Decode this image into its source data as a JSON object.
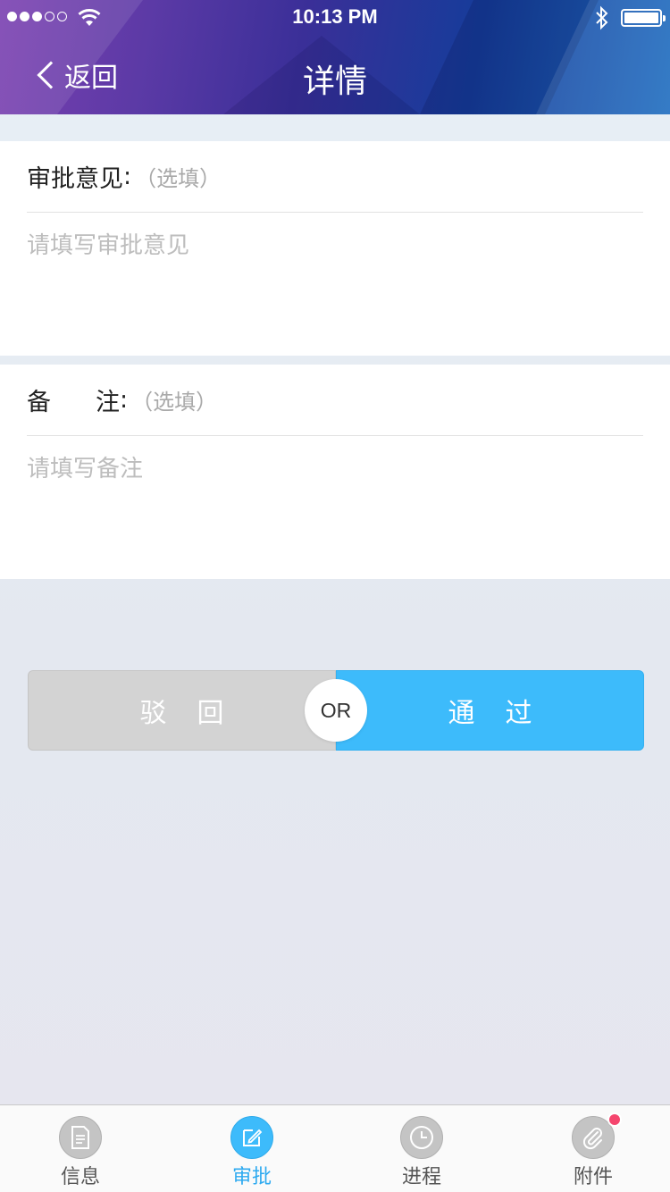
{
  "status_bar": {
    "time": "10:13 PM"
  },
  "nav": {
    "back_label": "返回",
    "title": "详情"
  },
  "approval": {
    "label": "审批意见",
    "colon": ":",
    "optional": "（选填）",
    "placeholder": "请填写审批意见"
  },
  "remark": {
    "label": "备注",
    "colon": ":",
    "optional": "（选填）",
    "placeholder": "请填写备注"
  },
  "actions": {
    "reject_label": "驳回",
    "or_label": "OR",
    "pass_label": "通过",
    "reject_color": "#d3d3d3",
    "pass_color": "#3dbbfb"
  },
  "tabbar": {
    "tabs": [
      {
        "label": "信息",
        "icon": "document-icon",
        "active": false
      },
      {
        "label": "审批",
        "icon": "edit-icon",
        "active": true
      },
      {
        "label": "进程",
        "icon": "clock-icon",
        "active": false
      },
      {
        "label": "附件",
        "icon": "paperclip-icon",
        "active": false,
        "badge": true
      }
    ],
    "active_color": "#3dbbfb",
    "badge_color": "#f5466e"
  }
}
